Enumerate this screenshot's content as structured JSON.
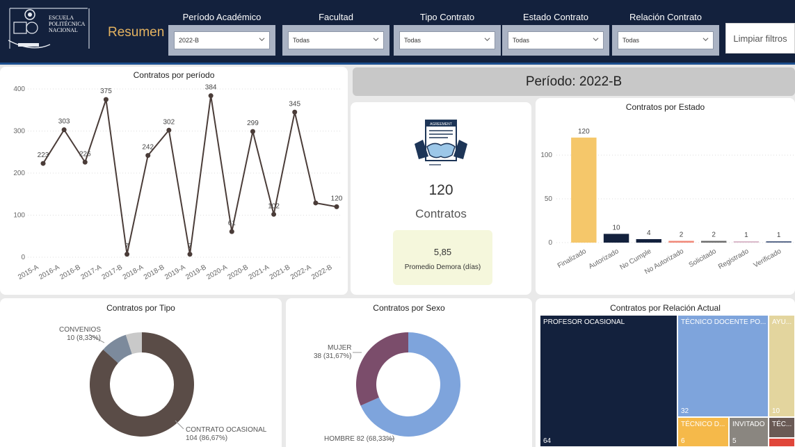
{
  "header": {
    "logo_lines": [
      "ESCUELA",
      "POLITÉCNICA",
      "NACIONAL"
    ],
    "page_title": "Resumen",
    "filters": [
      {
        "label": "Período Académico",
        "value": "2022-B"
      },
      {
        "label": "Facultad",
        "value": "Todas"
      },
      {
        "label": "Tipo Contrato",
        "value": "Todas"
      },
      {
        "label": "Estado Contrato",
        "value": "Todas"
      },
      {
        "label": "Relación Contrato",
        "value": "Todas"
      }
    ],
    "clear_button": "Limpiar filtros"
  },
  "period_banner": "Período: 2022-B",
  "kpi": {
    "contracts_value": "120",
    "contracts_label": "Contratos",
    "delay_value": "5,85",
    "delay_label": "Promedio Demora (días)",
    "icon_label": "AGREEMENT"
  },
  "titles": {
    "by_period": "Contratos por período",
    "by_state": "Contratos por Estado",
    "by_type": "Contratos por Tipo",
    "by_sex": "Contratos por Sexo",
    "by_relation": "Contratos por Relación Actual"
  },
  "chart_data": [
    {
      "type": "line",
      "title": "Contratos por período",
      "categories": [
        "2015-A",
        "2016-A",
        "2016-B",
        "2017-A",
        "2017-B",
        "2018-A",
        "2018-B",
        "2019-A",
        "2019-B",
        "2020-A",
        "2020-B",
        "2021-A",
        "2021-B",
        "2022-A",
        "2022-B"
      ],
      "values": [
        223,
        303,
        226,
        375,
        7,
        242,
        302,
        7,
        384,
        61,
        299,
        102,
        345,
        129,
        120
      ],
      "data_labels": [
        "223",
        "303",
        "226",
        "375",
        "7",
        "242",
        "302",
        "7",
        "384",
        "61",
        "299",
        "102",
        "345",
        "",
        "120"
      ],
      "y_ticks": [
        0,
        100,
        200,
        300,
        400
      ],
      "ylim": [
        0,
        400
      ],
      "color": "#4a3c38",
      "grid": true
    },
    {
      "type": "bar",
      "title": "Contratos por Estado",
      "categories": [
        "Finalizado",
        "Autorizado",
        "No Cumple",
        "No Autorizado",
        "Solicitado",
        "Registrado",
        "Verificado"
      ],
      "values": [
        120,
        10,
        4,
        2,
        2,
        1,
        1
      ],
      "colors": [
        "#f5c76a",
        "#13213d",
        "#13213d",
        "#f08878",
        "#6d6d6d",
        "#d9b8c9",
        "#5a6a8a"
      ],
      "y_ticks": [
        0,
        50,
        100
      ],
      "ylim": [
        0,
        135
      ],
      "grid": true
    },
    {
      "type": "pie",
      "title": "Contratos por Tipo",
      "slices": [
        {
          "label": "CONTRATO OCASIONAL",
          "value": 104,
          "pct": "86,67%",
          "color": "#5a4c47"
        },
        {
          "label": "CONVENIOS",
          "value": 10,
          "pct": "8,33%",
          "color": "#7c8a9c"
        },
        {
          "label": "",
          "value": 6,
          "pct": "",
          "color": "#c9c9c9"
        }
      ]
    },
    {
      "type": "pie",
      "title": "Contratos por Sexo",
      "slices": [
        {
          "label": "HOMBRE",
          "value": 82,
          "pct": "68,33%",
          "color": "#7ea4dc"
        },
        {
          "label": "MUJER",
          "value": 38,
          "pct": "31,67%",
          "color": "#7b4d6b"
        }
      ]
    },
    {
      "type": "treemap",
      "title": "Contratos por Relación Actual",
      "items": [
        {
          "label": "PROFESOR OCASIONAL",
          "value": 64,
          "value_label": "64",
          "color": "#13213d"
        },
        {
          "label": "TÉCNICO DOCENTE PO...",
          "value": 32,
          "value_label": "32",
          "color": "#7ea4dc"
        },
        {
          "label": "AYU...",
          "value": 10,
          "value_label": "10",
          "color": "#e3d59e"
        },
        {
          "label": "TÉCNICO D...",
          "value": 6,
          "value_label": "6",
          "color": "#f5b94a"
        },
        {
          "label": "INVITADO",
          "value": 5,
          "value_label": "5",
          "color": "#8a8680"
        },
        {
          "label": "TÉC...",
          "value": 3,
          "value_label": "",
          "color": "#6a5a55"
        },
        {
          "label": "",
          "value": 1,
          "value_label": "",
          "color": "#e0463a"
        }
      ]
    }
  ]
}
